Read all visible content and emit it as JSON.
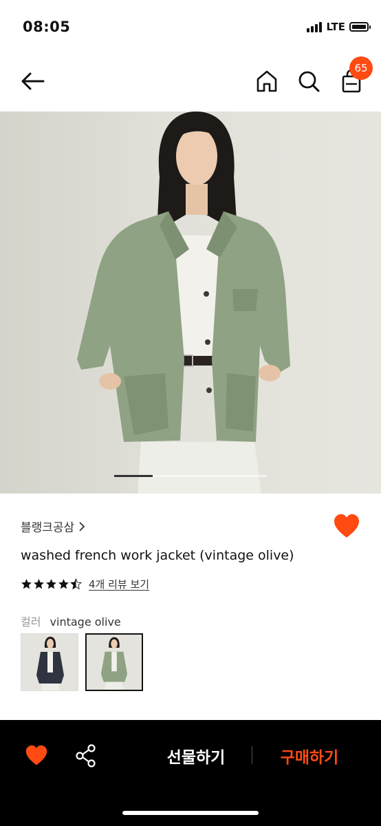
{
  "status_bar": {
    "time": "08:05",
    "network": "LTE"
  },
  "header": {
    "cart_count": "65"
  },
  "product": {
    "brand": "블랭크공삼",
    "brand_chevron": ">",
    "title": "washed french work jacket (vintage olive)",
    "rating": 4.5,
    "review_link": "4개 리뷰 보기",
    "color_label": "컬러",
    "color_value": "vintage olive",
    "image_index": {
      "current": 1,
      "total": 4
    }
  },
  "bottom_bar": {
    "gift_label": "선물하기",
    "buy_label": "구매하기"
  },
  "colors": {
    "accent": "#ff4a12",
    "jacket_olive": "#8fa283",
    "jacket_navy": "#2f3440"
  }
}
